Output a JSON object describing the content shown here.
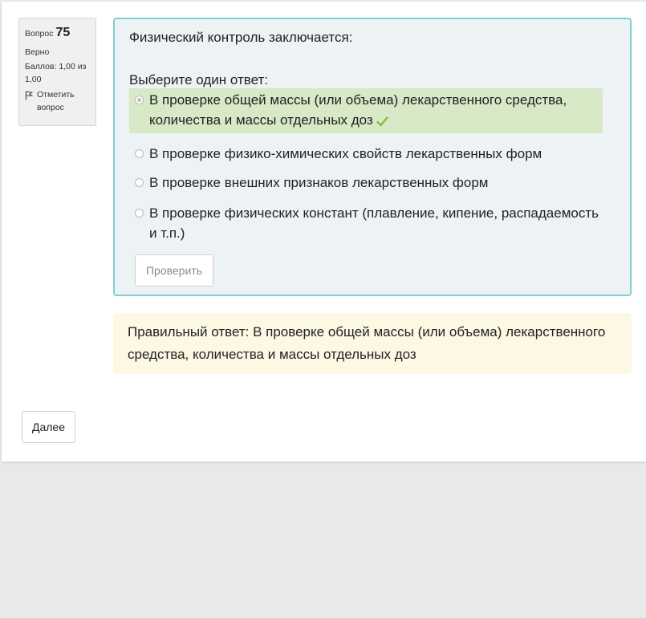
{
  "info": {
    "question_label": "Вопрос",
    "question_number": "75",
    "state": "Верно",
    "grade": "Баллов: 1,00 из 1,00",
    "flag_label": "Отметить вопрос"
  },
  "question": {
    "text": "Физический контроль заключается:",
    "prompt": "Выберите один ответ:",
    "options": [
      {
        "label": "В проверке общей массы (или объема) лекарственного средства, количества и массы отдельных доз",
        "selected": true,
        "correct": true
      },
      {
        "label": "В проверке физико-химических свойств лекарственных форм",
        "selected": false,
        "correct": false
      },
      {
        "label": "В проверке внешних признаков лекарственных форм",
        "selected": false,
        "correct": false
      },
      {
        "label": "В проверке физических констант (плавление, кипение, распадаемость и т.п.)",
        "selected": false,
        "correct": false
      }
    ],
    "check_button": "Проверить"
  },
  "feedback": {
    "right_answer": "Правильный ответ: В проверке общей массы (или объема) лекарственного средства, количества и массы отдельных доз"
  },
  "navigation": {
    "next_button": "Далее"
  },
  "colors": {
    "question_border": "#7fcfd1",
    "question_bg": "#edf2f5",
    "correct_bg": "#d7e9c7",
    "check_mark": "#7bbf3a",
    "feedback_bg": "#fcf8e3",
    "page_bg": "#e9e9e9"
  }
}
